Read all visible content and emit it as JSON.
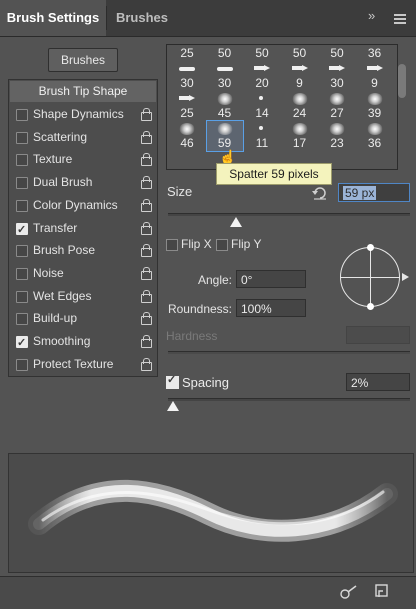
{
  "tabs": {
    "active": "Brush Settings",
    "inactive": "Brushes"
  },
  "header_icons": {
    "collapse": "collapse-icon",
    "menu": "panel-menu-icon",
    "collapse_glyph": "»"
  },
  "brushes_button": "Brushes",
  "brush_tip_shape": "Brush Tip Shape",
  "options": [
    {
      "label": "Shape Dynamics",
      "checked": false
    },
    {
      "label": "Scattering",
      "checked": false
    },
    {
      "label": "Texture",
      "checked": false
    },
    {
      "label": "Dual Brush",
      "checked": false
    },
    {
      "label": "Color Dynamics",
      "checked": false
    },
    {
      "label": "Transfer",
      "checked": true
    },
    {
      "label": "Brush Pose",
      "checked": false
    },
    {
      "label": "Noise",
      "checked": false
    },
    {
      "label": "Wet Edges",
      "checked": false
    },
    {
      "label": "Build-up",
      "checked": false
    },
    {
      "label": "Smoothing",
      "checked": true
    },
    {
      "label": "Protect Texture",
      "checked": false
    }
  ],
  "brush_grid": {
    "rows": [
      [
        {
          "label": "25",
          "mark": "none"
        },
        {
          "label": "50",
          "mark": "none"
        },
        {
          "label": "50",
          "mark": "none"
        },
        {
          "label": "50",
          "mark": "none"
        },
        {
          "label": "50",
          "mark": "none"
        },
        {
          "label": "36",
          "mark": "none"
        }
      ],
      [
        {
          "label": "30",
          "mark": "dash"
        },
        {
          "label": "30",
          "mark": "dash"
        },
        {
          "label": "20",
          "mark": "arrow"
        },
        {
          "label": "9",
          "mark": "arrow"
        },
        {
          "label": "30",
          "mark": "arrow"
        },
        {
          "label": "9",
          "mark": "arrow"
        }
      ],
      [
        {
          "label": "25",
          "mark": "arrow"
        },
        {
          "label": "45",
          "mark": "splat"
        },
        {
          "label": "14",
          "mark": "dot"
        },
        {
          "label": "24",
          "mark": "splat"
        },
        {
          "label": "27",
          "mark": "splat"
        },
        {
          "label": "39",
          "mark": "splat"
        }
      ],
      [
        {
          "label": "46",
          "mark": "splat"
        },
        {
          "label": "59",
          "mark": "splat",
          "selected": true
        },
        {
          "label": "11",
          "mark": "dot"
        },
        {
          "label": "17",
          "mark": "splat"
        },
        {
          "label": "23",
          "mark": "splat"
        },
        {
          "label": "36",
          "mark": "splat"
        }
      ]
    ]
  },
  "tooltip": "Spatter 59 pixels",
  "size": {
    "label": "Size",
    "value": "59 px",
    "slider_fraction": 0.28
  },
  "flip_x": "Flip X",
  "flip_y": "Flip Y",
  "angle": {
    "label": "Angle:",
    "value": "0°"
  },
  "roundness": {
    "label": "Roundness:",
    "value": "100%"
  },
  "hardness": {
    "label": "Hardness",
    "value": ""
  },
  "spacing": {
    "label": "Spacing",
    "value": "2%",
    "checked": true,
    "slider_fraction": 0.02
  },
  "bottom_icons": [
    "toggle-live-tip-preview-icon",
    "new-brush-icon"
  ]
}
